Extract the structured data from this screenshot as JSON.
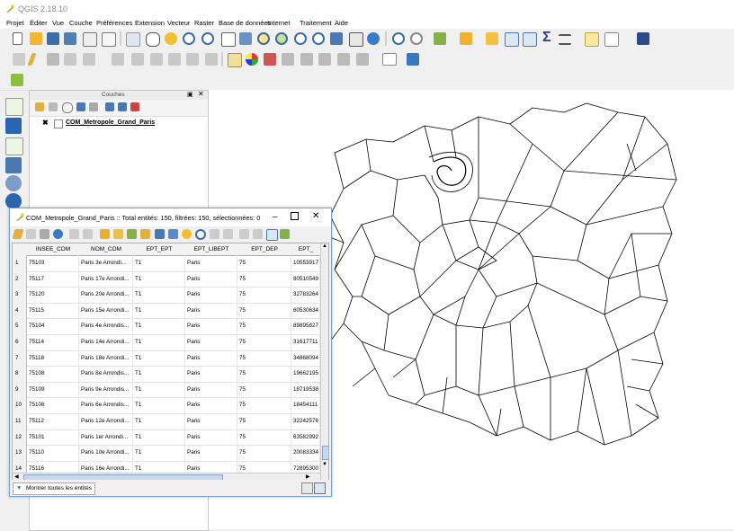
{
  "app": {
    "title": "QGIS 2.18.10"
  },
  "menu": [
    "Projet",
    "Éditer",
    "Vue",
    "Couche",
    "Préférences",
    "Extension",
    "Vecteur",
    "Raster",
    "Base de données",
    "Internet",
    "Traitement",
    "Aide"
  ],
  "layers_panel": {
    "title": "Couches",
    "layer_name": "COM_Metropole_Grand_Paris"
  },
  "attribute_table": {
    "title": "COM_Metropole_Grand_Paris :: Total entités: 150, filtrées: 150, sélectionnées: 0",
    "columns": [
      "INSEE_COM",
      "NOM_COM",
      "EPT_EPT",
      "EPT_LIBEPT",
      "EPT_DEP",
      "EPT_"
    ],
    "rows": [
      [
        "1",
        "75103",
        "Paris 3e Arrondi...",
        "T1",
        "Paris",
        "75",
        "10553917"
      ],
      [
        "2",
        "75117",
        "Paris 17e Arrondi...",
        "T1",
        "Paris",
        "75",
        "80510549"
      ],
      [
        "3",
        "75120",
        "Paris 20e Arrondi...",
        "T1",
        "Paris",
        "75",
        "32783264"
      ],
      [
        "4",
        "75115",
        "Paris 15e Arrondi...",
        "T1",
        "Paris",
        "75",
        "60530634"
      ],
      [
        "5",
        "75104",
        "Paris 4e Arrondis...",
        "T1",
        "Paris",
        "75",
        "89895827"
      ],
      [
        "6",
        "75114",
        "Paris 14e Arrondi...",
        "T1",
        "Paris",
        "75",
        "31617711"
      ],
      [
        "7",
        "75118",
        "Paris 18e Arrondi...",
        "T1",
        "Paris",
        "75",
        "34868094"
      ],
      [
        "8",
        "75108",
        "Paris 8e Arrondis...",
        "T1",
        "Paris",
        "75",
        "19662195"
      ],
      [
        "9",
        "75109",
        "Paris 9e Arrondis...",
        "T1",
        "Paris",
        "75",
        "18719538"
      ],
      [
        "10",
        "75106",
        "Paris 6e Arrondis...",
        "T1",
        "Paris",
        "75",
        "18454111"
      ],
      [
        "11",
        "75112",
        "Paris 12e Arrondi...",
        "T1",
        "Paris",
        "75",
        "32242576"
      ],
      [
        "12",
        "75101",
        "Paris 1er Arrondi...",
        "T1",
        "Paris",
        "75",
        "63582992"
      ],
      [
        "13",
        "75110",
        "Paris 10e Arrondi...",
        "T1",
        "Paris",
        "75",
        "20083334"
      ],
      [
        "14",
        "75116",
        "Paris 16e Arrondi...",
        "T1",
        "Paris",
        "75",
        "72895300"
      ]
    ],
    "show_all_label": "Montrer toutes les entités"
  },
  "colors": {
    "accent": "#2e6fb7",
    "window_border": "#7aa0c8",
    "map_line": "#000000"
  },
  "icons": [
    "qgis-logo-icon",
    "new-icon",
    "open-icon",
    "save-icon",
    "pan-icon",
    "zoom-in-icon",
    "zoom-out-icon",
    "identify-icon",
    "sum-icon",
    "filter-icon",
    "close-icon",
    "minimize-icon",
    "maximize-icon"
  ]
}
